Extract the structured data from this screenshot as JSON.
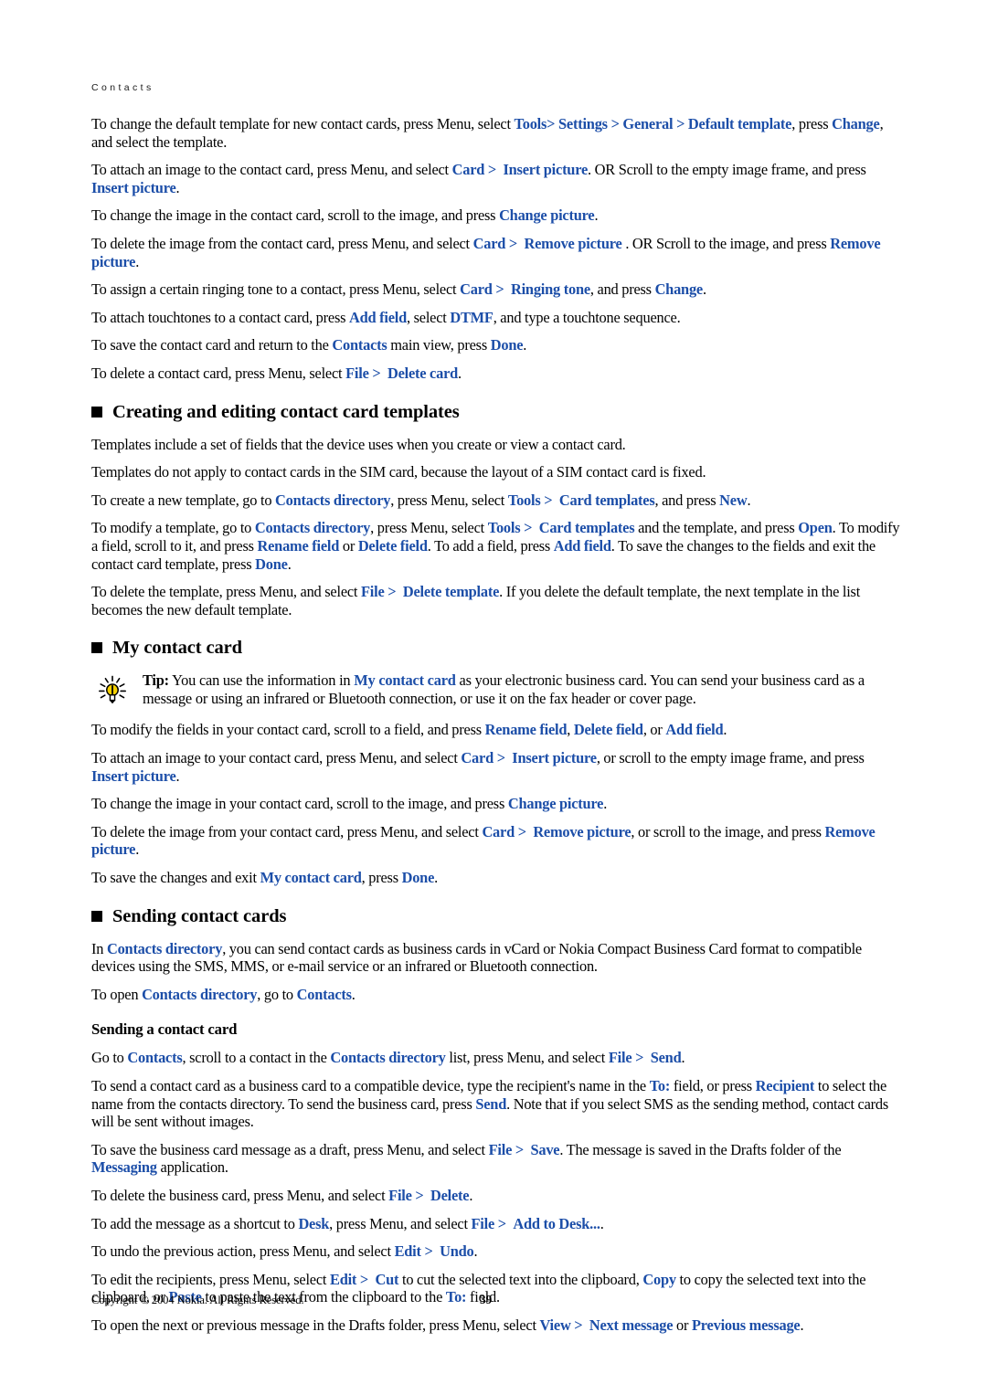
{
  "header": {
    "running_title": "Contacts"
  },
  "colors": {
    "link_blue": "#1c4ea8",
    "text_black": "#000000",
    "tip_bulb_yellow": "#f5d000",
    "page_background": "#ffffff"
  },
  "paragraphs": {
    "p1_a": "To change the default template for new contact cards, press Menu, select ",
    "p1_tools": "Tools",
    "p1_gt1": ">",
    "p1_settings": "Settings",
    "p1_gt2": ">",
    "p1_general": "General",
    "p1_gt3": ">",
    "p1_default_template": "Default template",
    "p1_b": ", press ",
    "p1_change": "Change",
    "p1_c": ", and select the template.",
    "p2_a": "To attach an image to the contact card, press Menu, and select ",
    "p2_card": "Card",
    "p2_gt": ">",
    "p2_insert_picture": "Insert picture",
    "p2_b": ". OR Scroll to the empty image frame, and press ",
    "p2_insert_picture2": "Insert picture",
    "p2_c": ".",
    "p3_a": "To change the image in the contact card, scroll to the image, and press ",
    "p3_change_picture": "Change picture",
    "p3_b": ".",
    "p4_a": "To delete the image from the contact card, press Menu, and select ",
    "p4_card": "Card",
    "p4_gt": ">",
    "p4_remove_picture": "Remove picture",
    "p4_b": ". OR Scroll to the image, and press ",
    "p4_remove_picture2": "Remove picture",
    "p4_c": ".",
    "p5_a": "To assign a certain ringing tone to a contact, press Menu, select ",
    "p5_card": "Card",
    "p5_gt": ">",
    "p5_ringing_tone": "Ringing tone",
    "p5_b": ", and press ",
    "p5_change": "Change",
    "p5_c": ".",
    "p6_a": "To attach touchtones to a contact card, press ",
    "p6_add_field": "Add field",
    "p6_b": ", select ",
    "p6_dtmf": "DTMF",
    "p6_c": ", and type a touchtone sequence.",
    "p7_a": "To save the contact card and return to the ",
    "p7_contacts": "Contacts",
    "p7_b": " main view, press ",
    "p7_done": "Done",
    "p7_c": ".",
    "p8_a": "To delete a contact card, press Menu, select ",
    "p8_file": "File",
    "p8_gt": ">",
    "p8_delete_card": "Delete card",
    "p8_b": ".",
    "p9": "Templates include a set of fields that the device uses when you create or view a contact card.",
    "p10": "Templates do not apply to contact cards in the SIM card, because the layout of a SIM contact card is fixed.",
    "p11_a": "To create a new template, go to ",
    "p11_contacts_directory": "Contacts directory",
    "p11_b": ", press Menu, select ",
    "p11_tools": "Tools",
    "p11_gt": ">",
    "p11_card_templates": "Card templates",
    "p11_c": ", and press ",
    "p11_new": "New",
    "p11_d": ".",
    "p12_a": "To modify a template, go to ",
    "p12_contacts_directory": "Contacts directory",
    "p12_b": ", press Menu, select ",
    "p12_tools": "Tools",
    "p12_gt": ">",
    "p12_card_templates": "Card templates",
    "p12_c": " and the template, and press ",
    "p12_open": "Open",
    "p12_d": ". To modify a field, scroll to it, and press ",
    "p12_rename_field": "Rename field",
    "p12_e": " or ",
    "p12_delete_field": "Delete field",
    "p12_f": ". To add a field, press ",
    "p12_add_field": "Add field",
    "p12_g": ". To save the changes to the fields and exit the contact card template, press ",
    "p12_done": "Done",
    "p12_h": ".",
    "p13_a": "To delete the template, press Menu, and select ",
    "p13_file": "File",
    "p13_gt": ">",
    "p13_delete_template": "Delete template",
    "p13_b": ". If you delete the default template, the next template in the list becomes the new default template.",
    "tip_label": "Tip:",
    "tip_a": " You can use the information in ",
    "tip_my_contact_card": "My contact card",
    "tip_b": " as your electronic business card. You can send your business card as a message or using an infrared or Bluetooth connection, or use it on the fax header or cover page.",
    "p14_a": "To modify the fields in your contact card, scroll to a field, and press ",
    "p14_rename_field": "Rename field",
    "p14_b": ", ",
    "p14_delete_field": "Delete field",
    "p14_c": ", or ",
    "p14_add_field": "Add field",
    "p14_d": ".",
    "p15_a": "To attach an image to your contact card, press Menu, and select ",
    "p15_card": "Card",
    "p15_gt": ">",
    "p15_insert_picture": "Insert picture",
    "p15_b": ", or scroll to the empty image frame, and press ",
    "p15_insert_picture2": "Insert picture",
    "p15_c": ".",
    "p16_a": "To change the image in your contact card, scroll to the image, and press ",
    "p16_change_picture": "Change picture",
    "p16_b": ".",
    "p17_a": "To delete the image from your contact card, press Menu, and select ",
    "p17_card": "Card",
    "p17_gt": ">",
    "p17_remove_picture": "Remove picture",
    "p17_b": ", or scroll to the image, and press ",
    "p17_remove_picture2": "Remove picture",
    "p17_c": ".",
    "p18_a": "To save the changes and exit ",
    "p18_my_contact_card": "My contact card",
    "p18_b": ", press ",
    "p18_done": "Done",
    "p18_c": ".",
    "p19_a": "In ",
    "p19_contacts_directory": "Contacts directory",
    "p19_b": ", you can send contact cards as business cards in vCard or Nokia Compact Business Card format to compatible devices using the SMS, MMS, or e-mail service or an infrared or Bluetooth connection.",
    "p20_a": "To open ",
    "p20_contacts_directory": "Contacts directory",
    "p20_b": ", go to ",
    "p20_contacts": "Contacts",
    "p20_c": ".",
    "p21_a": "Go to ",
    "p21_contacts": "Contacts",
    "p21_b": ", scroll to a contact in the ",
    "p21_contacts_directory": "Contacts directory",
    "p21_c": " list, press Menu, and select ",
    "p21_file": "File",
    "p21_gt": ">",
    "p21_send": "Send",
    "p21_d": ".",
    "p22_a": "To send a contact card as a business card to a compatible device, type the recipient's name in the ",
    "p22_to": "To:",
    "p22_b": " field, or press ",
    "p22_recipient": "Recipient",
    "p22_c": " to select the name from the contacts directory. To send the business card, press ",
    "p22_send": "Send",
    "p22_d": ". Note that if you select SMS as the sending method, contact cards will be sent without images.",
    "p23_a": "To save the business card message as a draft, press Menu, and select ",
    "p23_file": "File",
    "p23_gt": ">",
    "p23_save": "Save",
    "p23_b": ". The message is saved in the Drafts folder of the ",
    "p23_messaging": "Messaging",
    "p23_c": " application.",
    "p24_a": "To delete the business card, press Menu, and select ",
    "p24_file": "File",
    "p24_gt": ">",
    "p24_delete": "Delete",
    "p24_b": ".",
    "p25_a": "To add the message as a shortcut to ",
    "p25_desk": "Desk",
    "p25_b": ", press Menu, and select ",
    "p25_file": "File",
    "p25_gt": ">",
    "p25_add_to_desk": "Add to Desk...",
    "p25_c": ".",
    "p26_a": "To undo the previous action, press Menu, and select ",
    "p26_edit": "Edit",
    "p26_gt": ">",
    "p26_undo": "Undo",
    "p26_b": ".",
    "p27_a": "To edit the recipients, press Menu, select ",
    "p27_edit": "Edit",
    "p27_gt": ">",
    "p27_cut": "Cut",
    "p27_b": " to cut the selected text into the clipboard, ",
    "p27_copy": "Copy",
    "p27_c": " to copy the selected text into the clipboard, or ",
    "p27_paste": "Paste",
    "p27_d": " to paste the text from the clipboard to the ",
    "p27_to": "To:",
    "p27_e": " field.",
    "p28_a": "To open the next or previous message in the Drafts folder, press Menu, select ",
    "p28_view": "View",
    "p28_gt": ">",
    "p28_next_message": "Next message",
    "p28_b": " or ",
    "p28_previous_message": "Previous message",
    "p28_c": "."
  },
  "headings": {
    "h1": "Creating and editing contact card templates",
    "h2": "My contact card",
    "h3": "Sending contact cards",
    "sub1": "Sending a contact card"
  },
  "footer": {
    "copyright": "Copyright © 2004 Nokia. All Rights Reserved.",
    "page_number": "39"
  }
}
